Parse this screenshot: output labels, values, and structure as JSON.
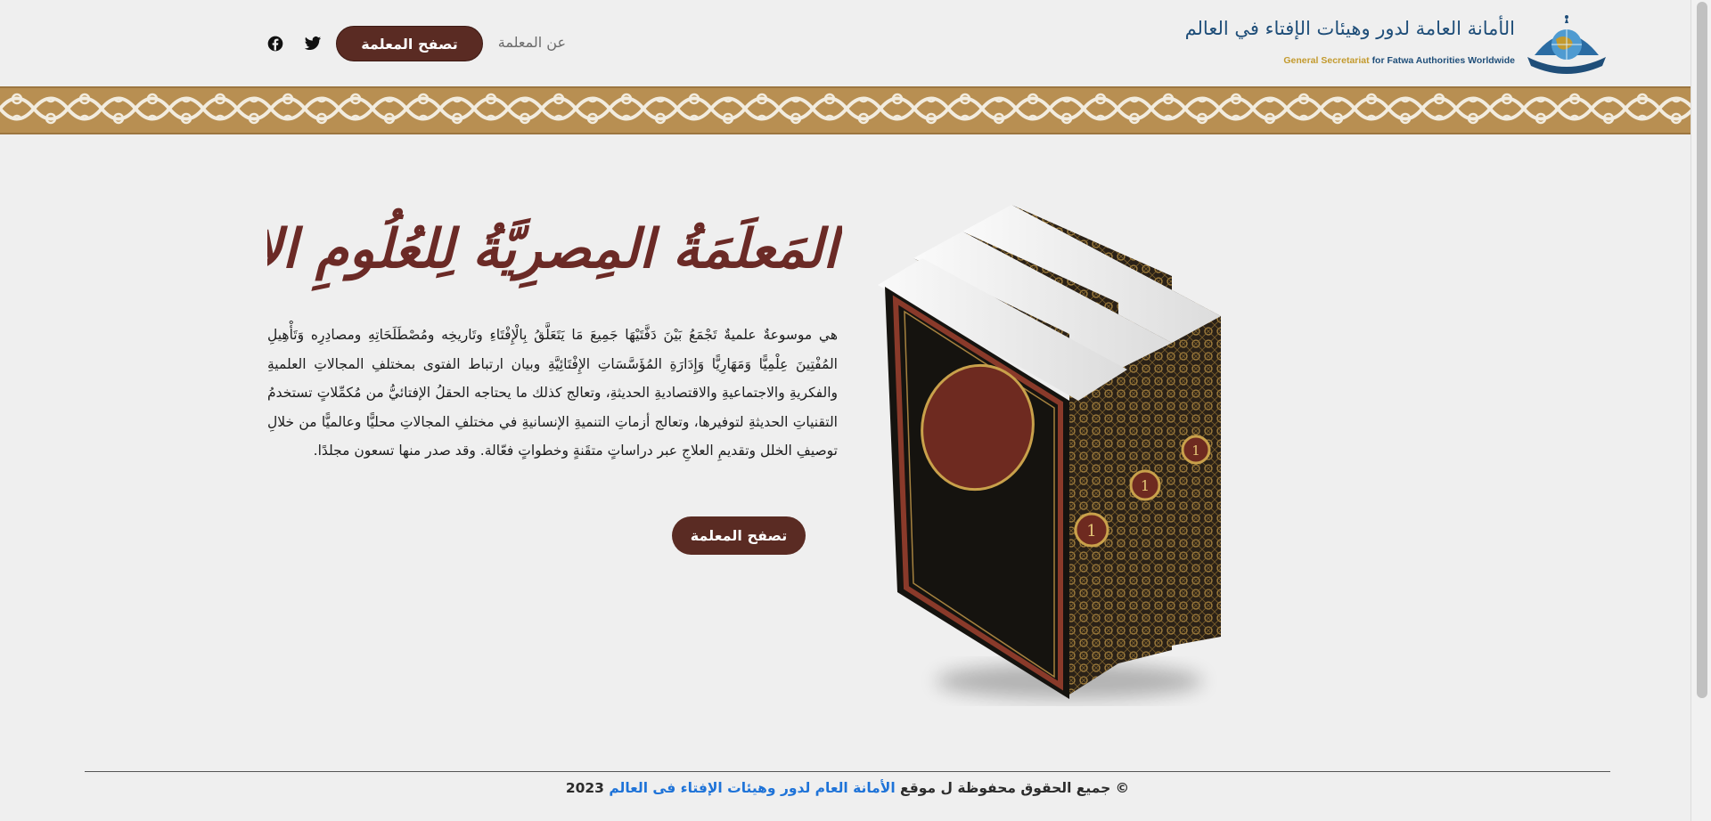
{
  "header": {
    "logo": {
      "arabic_name": "الأمانة العامة لدور وهيئات الإفتاء في العالم",
      "english_prefix": "General Secretariat",
      "english_suffix": "for Fatwa Authorities Worldwide",
      "emblem_icon": "globe-dome-emblem-icon"
    },
    "nav": {
      "about_label": "عن المعلمة",
      "browse_label": "تصفح المعلمة"
    },
    "social": [
      {
        "name": "twitter-icon"
      },
      {
        "name": "facebook-icon"
      }
    ]
  },
  "hero": {
    "title": "المَعلَمَةُ المِصرِيَّةُ لِلعُلُومِ الإفتَائِيَّةِ",
    "description": "هي موسوعةٌ علميةٌ تَجْمَعُ بَيْنَ دَفَّتَيْهَا جَمِيعَ مَا يَتَعَلَّقُ بِالْإِفْتَاءِ وتَاريخِه ومُصْطَلَحَاتِهِ ومصادِرِه وَتَأْهِيلِ المُفْتِينَ عِلْمِيًّا وَمَهَارِيًّا وَإِدَارَةِ المُؤَسَّسَاتِ الإِفْتَائِيَّةِ وبيان ارتباط الفتوى بمختلفِ المجالاتِ العلميةِ والفكريةِ والاجتماعيةِ والاقتصاديةِ الحديثةِ، وتعالج كذلك ما يحتاجه الحقلُ الإفتائيُّ من مُكمِّلاتٍ تستخدمُ التقنياتِ الحديثةِ لتوفيرها، وتعالج أزماتِ التنميةِ الإنسانيةِ في مختلفِ المجالاتِ محليًّا وعالميًّا من خلالِ توصيفِ الخلل وتقديمِ العلاجِ عبر دراساتٍ متقَنةٍ وخطواتٍ فعّالة. وقد صدر منها تسعون مجلدًا.",
    "button_label": "تصفح المعلمة",
    "books_image": "three-volume-book-set-image"
  },
  "footer": {
    "prefix": "© جميع الحقوق محفوظة ل موقع",
    "link_text": "الأمانة العام لدور وهيئات الإفتاء فى العالم",
    "year": "2023"
  },
  "colors": {
    "primary_button": "#5a2b23",
    "title_color": "#6b2a26",
    "pattern_gold": "#b88f52",
    "link_blue": "#1e73d8",
    "background": "#efefef"
  }
}
